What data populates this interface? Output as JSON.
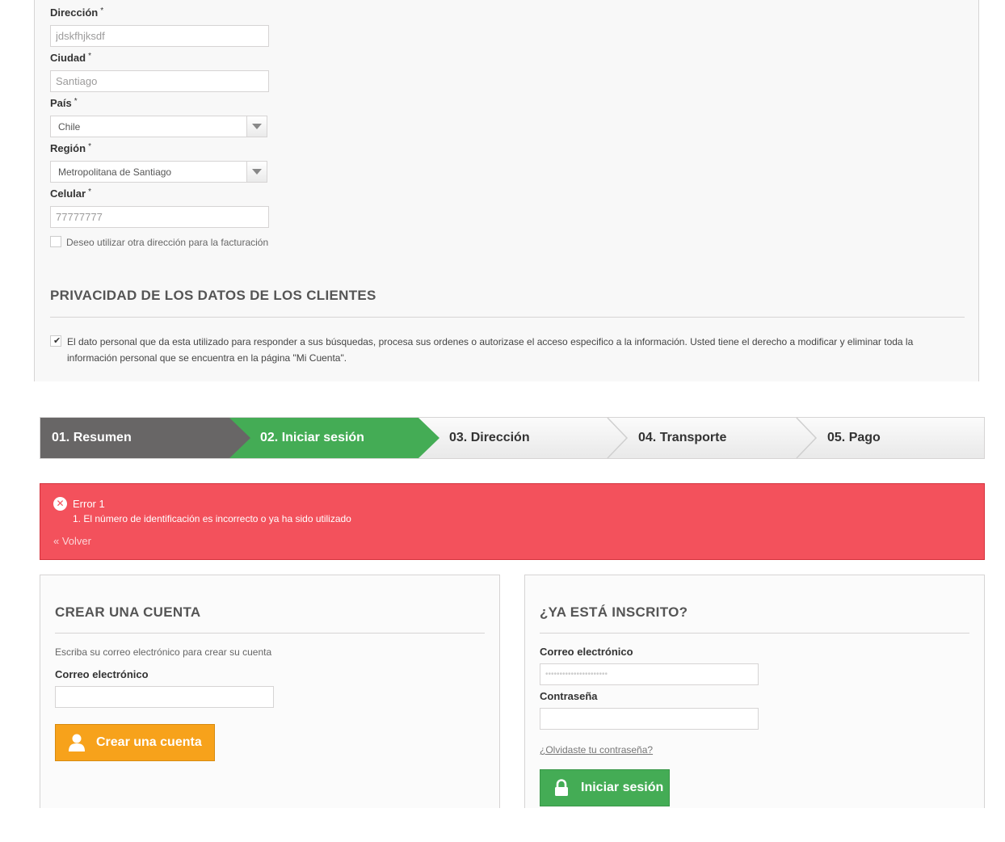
{
  "address_form": {
    "direccion": {
      "label": "Dirección",
      "required": "*",
      "value": "jdskfhjksdf"
    },
    "ciudad": {
      "label": "Ciudad",
      "required": "*",
      "value": "Santiago"
    },
    "pais": {
      "label": "País",
      "required": "*",
      "value": "Chile"
    },
    "region": {
      "label": "Región",
      "required": "*",
      "value": "Metropolitana de Santiago"
    },
    "celular": {
      "label": "Celular",
      "required": "*",
      "value": "77777777"
    },
    "billing_checkbox_label": "Deseo utilizar otra dirección para la facturación"
  },
  "privacy": {
    "title": "PRIVACIDAD DE LOS DATOS DE LOS CLIENTES",
    "text": "El dato personal que da esta utilizado para responder a sus búsquedas, procesa sus ordenes o autorizase el acceso especifico a la información. Usted tiene el derecho a modificar y eliminar toda la información personal que se encuentra en la página \"Mi Cuenta\"."
  },
  "steps": [
    {
      "label": "01. Resumen"
    },
    {
      "label": "02. Iniciar sesión"
    },
    {
      "label": "03. Dirección"
    },
    {
      "label": "04. Transporte"
    },
    {
      "label": "05. Pago"
    }
  ],
  "error": {
    "title": "Error 1",
    "items": [
      "1.  El número de identificación es incorrecto o ya ha sido utilizado"
    ],
    "back_link": "« Volver"
  },
  "create_account": {
    "title": "CREAR UNA CUENTA",
    "instructions": "Escriba su correo electrónico para crear su cuenta",
    "email_label": "Correo electrónico",
    "email_value": "",
    "button": "Crear una cuenta"
  },
  "login": {
    "title": "¿YA ESTÁ INSCRITO?",
    "email_label": "Correo electrónico",
    "email_value": "••••••••••••••••••••••",
    "password_label": "Contraseña",
    "password_value": "",
    "forgot_link": "¿Olvidaste tu contraseña?",
    "button": "Iniciar sesión"
  },
  "colors": {
    "step_done": "#686666",
    "step_current": "#44ac55",
    "error_bg": "#f3515c",
    "orange_button": "#f7a21b",
    "green_button": "#44ac55"
  }
}
